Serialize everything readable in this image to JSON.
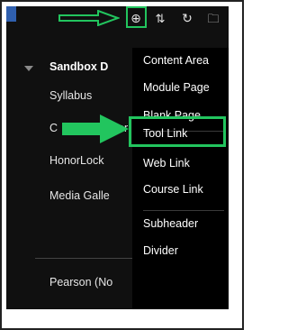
{
  "toolbar": {
    "icons": [
      "add-icon",
      "reorder-icon",
      "refresh-icon",
      "folder-icon"
    ],
    "add_glyph": "⊕",
    "reorder_glyph": "⇅",
    "refresh_glyph": "↻",
    "folder_glyph": "🗀"
  },
  "course": {
    "title": "Sandbox D"
  },
  "nav": {
    "items": [
      {
        "label": "Syllabus"
      },
      {
        "label": "C"
      },
      {
        "label": "or"
      },
      {
        "label": "HonorLock"
      },
      {
        "label": "Media Galle"
      },
      {
        "label": "Pearson (No"
      }
    ]
  },
  "menu": {
    "items": [
      {
        "label": "Content Area"
      },
      {
        "label": "Module Page"
      },
      {
        "label": "Blank Page"
      },
      {
        "label": "Tool Link"
      },
      {
        "label": "Web Link"
      },
      {
        "label": "Course Link"
      },
      {
        "label": "Subheader"
      },
      {
        "label": "Divider"
      }
    ]
  },
  "colors": {
    "panel_bg": "#101010",
    "menu_bg": "#000000",
    "highlight": "#22c55e",
    "accent_blue": "#2f5fae"
  }
}
